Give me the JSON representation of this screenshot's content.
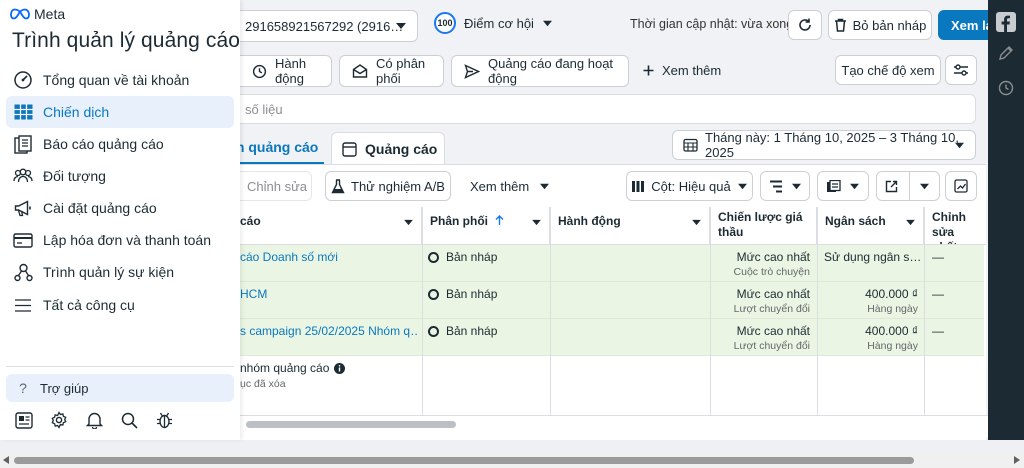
{
  "app": {
    "brand": "Meta",
    "title": "Trình quản lý quảng cáo"
  },
  "sidebar": {
    "items": [
      {
        "label": "Tổng quan về tài khoản",
        "icon": "dashboard-gauge-icon"
      },
      {
        "label": "Chiến dịch",
        "icon": "table-grid-icon",
        "active": true
      },
      {
        "label": "Báo cáo quảng cáo",
        "icon": "report-document-icon"
      },
      {
        "label": "Đối tượng",
        "icon": "audience-people-icon"
      },
      {
        "label": "Cài đặt quảng cáo",
        "icon": "megaphone-icon"
      },
      {
        "label": "Lập hóa đơn và thanh toán",
        "icon": "credit-card-icon"
      },
      {
        "label": "Trình quản lý sự kiện",
        "icon": "events-graph-icon"
      },
      {
        "label": "Tất cả công cụ",
        "icon": "hamburger-menu-icon"
      }
    ],
    "help": "Trợ giúp",
    "footer_icons": [
      "news-feed-icon",
      "settings-gear-icon",
      "notifications-bell-icon",
      "search-icon",
      "bug-report-icon"
    ]
  },
  "header": {
    "account_selector": "291658921567292 (2916…",
    "opportunity_score": "100",
    "opportunity_label": "Điểm cơ hội",
    "last_updated": "Thời gian cập nhật: vừa xong",
    "discard_drafts": "Bỏ bản nháp",
    "review_publish": "Xem lại"
  },
  "filters": {
    "chips": [
      "Hành động",
      "Có phân phối",
      "Quảng cáo đang hoạt động"
    ],
    "more": "Xem thêm",
    "create_view": "Tạo chế độ xem"
  },
  "search": {
    "placeholder": "số liệu"
  },
  "tabs": {
    "campaigns": "m quảng cáo",
    "ads": "Quảng cáo"
  },
  "date_range": "Tháng này: 1 Tháng 10, 2025 – 3 Tháng 10, 2025",
  "toolbar": {
    "edit": "Chỉnh sửa",
    "ab_test": "Thử nghiệm A/B",
    "more": "Xem thêm",
    "columns": "Cột: Hiệu quả"
  },
  "table": {
    "headers": {
      "name": "cáo",
      "delivery": "Phân phối",
      "actions": "Hành động",
      "bid_strategy": "Chiến lược giá thầu",
      "budget": "Ngân sách",
      "last_edit": "Chỉnh sửa nhất"
    },
    "rows": [
      {
        "name": "cáo Doanh số mới",
        "delivery": "Bản nháp",
        "bid": "Mức cao nhất",
        "bid_sub": "Cuộc trò chuyện",
        "budget": "Sử dụng ngân s…",
        "budget_sub": "",
        "edit": "—"
      },
      {
        "name": "HCM",
        "delivery": "Bản nháp",
        "bid": "Mức cao nhất",
        "bid_sub": "Lượt chuyển đổi",
        "budget": "400.000 ₫",
        "budget_sub": "Hàng ngày",
        "edit": "—"
      },
      {
        "name": "s campaign 25/02/2025 Nhóm q…",
        "delivery": "Bản nháp",
        "bid": "Mức cao nhất",
        "bid_sub": "Lượt chuyển đổi",
        "budget": "400.000 ₫",
        "budget_sub": "Hàng ngày",
        "edit": "—"
      }
    ],
    "summary": {
      "label": "nhóm quảng cáo",
      "sub": "ục đã xóa"
    }
  }
}
